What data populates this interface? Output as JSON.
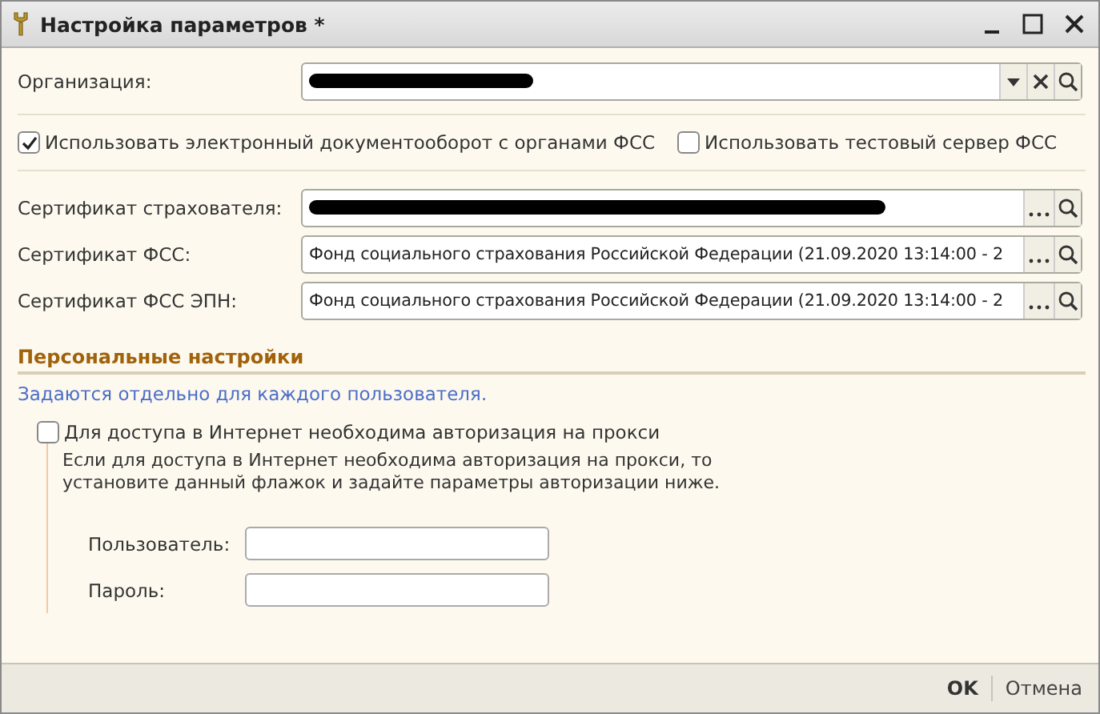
{
  "window": {
    "title": "Настройка параметров *"
  },
  "organization": {
    "label": "Организация:",
    "redacted": true
  },
  "checkboxes": [
    {
      "label": "Использовать электронный документооборот с органами ФСС",
      "checked": true
    },
    {
      "label": "Использовать тестовый сервер ФСС",
      "checked": false
    }
  ],
  "certificates": [
    {
      "label": "Сертификат страхователя:",
      "redacted": true
    },
    {
      "label": "Сертификат ФСС:",
      "redacted": false,
      "value": "Фонд социального страхования Российской Федерации (21.09.2020 13:14:00 - 2"
    },
    {
      "label": "Сертификат ФСС ЭПН:",
      "redacted": false,
      "value": "Фонд социального страхования Российской Федерации (21.09.2020 13:14:00 - 2"
    }
  ],
  "personal": {
    "title": "Персональные настройки",
    "note": "Задаются отдельно для каждого пользователя.",
    "proxy": {
      "label": "Для доступа в Интернет необходима авторизация на прокси",
      "checked": false,
      "hint": "Если для доступа в Интернет необходима авторизация на прокси, то установите данный флажок и задайте параметры авторизации ниже.",
      "fields": [
        {
          "label": "Пользователь:"
        },
        {
          "label": "Пароль:"
        }
      ]
    }
  },
  "buttons": [
    {
      "label": "OK",
      "default": true
    },
    {
      "label": "Отмена",
      "default": false
    }
  ]
}
